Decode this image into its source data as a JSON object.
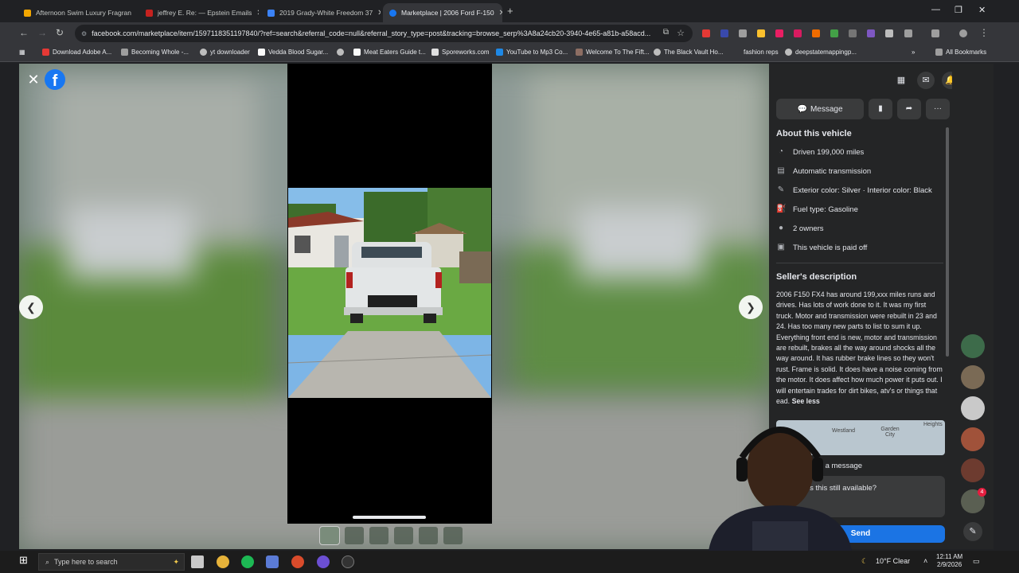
{
  "browser": {
    "tabs": [
      {
        "title": "Afternoon Swim Luxury Fragran",
        "color": "#f2a600",
        "active": false
      },
      {
        "title": "jeffrey E. Re: — Epstein Emails",
        "color": "#c5221f",
        "active": false
      },
      {
        "title": "2019 Grady-White Freedom 37",
        "color": "#3b82f6",
        "active": false
      },
      {
        "title": "Marketplace | 2006 Ford F-150",
        "color": "#1877f2",
        "active": true
      }
    ],
    "url": "facebook.com/marketplace/item/1597118351197840/?ref=search&referral_code=null&referral_story_type=post&tracking=browse_serp%3A8a24cb20-3940-4e65-a81b-a58acd...",
    "bookmarks": [
      "Download Adobe A...",
      "Becoming Whole -...",
      "yt downloader",
      "Vedda Blood Sugar...",
      "Meat Eaters Guide t...",
      "Sporeworks.com",
      "YouTube to Mp3 Co...",
      "Welcome To The Fift...",
      "The Black Vault Ho...",
      "fashion reps",
      "deepstatemappingp..."
    ],
    "all_bookmarks": "All Bookmarks"
  },
  "listing": {
    "actions": {
      "message": "Message"
    },
    "about_title": "About this vehicle",
    "attributes": [
      {
        "icon": "speedometer-icon",
        "text": "Driven 199,000 miles"
      },
      {
        "icon": "transmission-icon",
        "text": "Automatic transmission"
      },
      {
        "icon": "paint-icon",
        "text": "Exterior color: Silver · Interior color: Black"
      },
      {
        "icon": "fuel-icon",
        "text": "Fuel type: Gasoline"
      },
      {
        "icon": "person-icon",
        "text": "2 owners"
      },
      {
        "icon": "paid-icon",
        "text": "This vehicle is paid off"
      }
    ],
    "seller_description_title": "Seller's description",
    "description": "2006 F150 FX4 has around 199,xxx miles runs and drives. Has lots of work done to it. It was my first truck. Motor and transmission were rebuilt in 23 and 24. Has too many new parts to list to sum it up. Everything front end is new, motor and transmission are rebuilt, brakes all the way around shocks all the way around. It has rubber brake lines so they won't rust. Frame is solid. It does have a noise coming from the motor. It does affect how much power it puts out. I will entertain trades for dirt bikes, atv's or things that",
    "description_tail": "ead.",
    "see_less": "See less",
    "map_labels": [
      "Westland",
      "Garden City",
      "Heights"
    ],
    "send_message_label": "eller a message",
    "message_text": "is this still available?",
    "send": "Send"
  },
  "taskbar": {
    "search_placeholder": "Type here to search",
    "weather": "10°F Clear",
    "time": "12:11 AM",
    "date": "2/9/2026"
  },
  "rail_badge": "4"
}
